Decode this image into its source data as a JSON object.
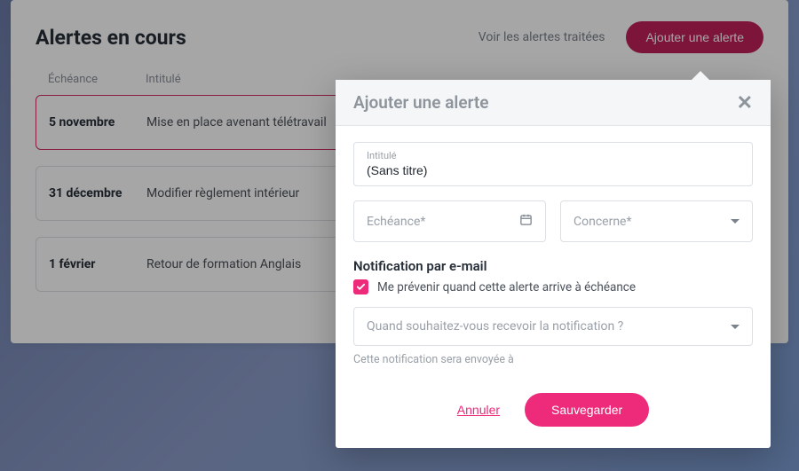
{
  "header": {
    "title": "Alertes en cours",
    "link_treated": "Voir les alertes traitées",
    "add_button": "Ajouter une alerte"
  },
  "table": {
    "columns": {
      "date": "Échéance",
      "title": "Intitulé"
    },
    "rows": [
      {
        "date": "5 novembre",
        "title": "Mise en place avenant télétravail",
        "highlight": true
      },
      {
        "date": "31 décembre",
        "title": "Modifier règlement intérieur",
        "highlight": false
      },
      {
        "date": "1 février",
        "title": "Retour de formation Anglais",
        "highlight": false
      }
    ]
  },
  "modal": {
    "title": "Ajouter une alerte",
    "intitule": {
      "label": "Intitulé",
      "value": "(Sans titre)"
    },
    "echeance_placeholder": "Echéance*",
    "concerne_placeholder": "Concerne*",
    "notif_heading": "Notification par e-mail",
    "notif_check_label": "Me prévenir quand cette alerte arrive à échéance",
    "notif_when_placeholder": "Quand souhaitez-vous recevoir la notification ?",
    "notif_help": "Cette notification sera envoyée à",
    "cancel": "Annuler",
    "save": "Sauvegarder"
  }
}
